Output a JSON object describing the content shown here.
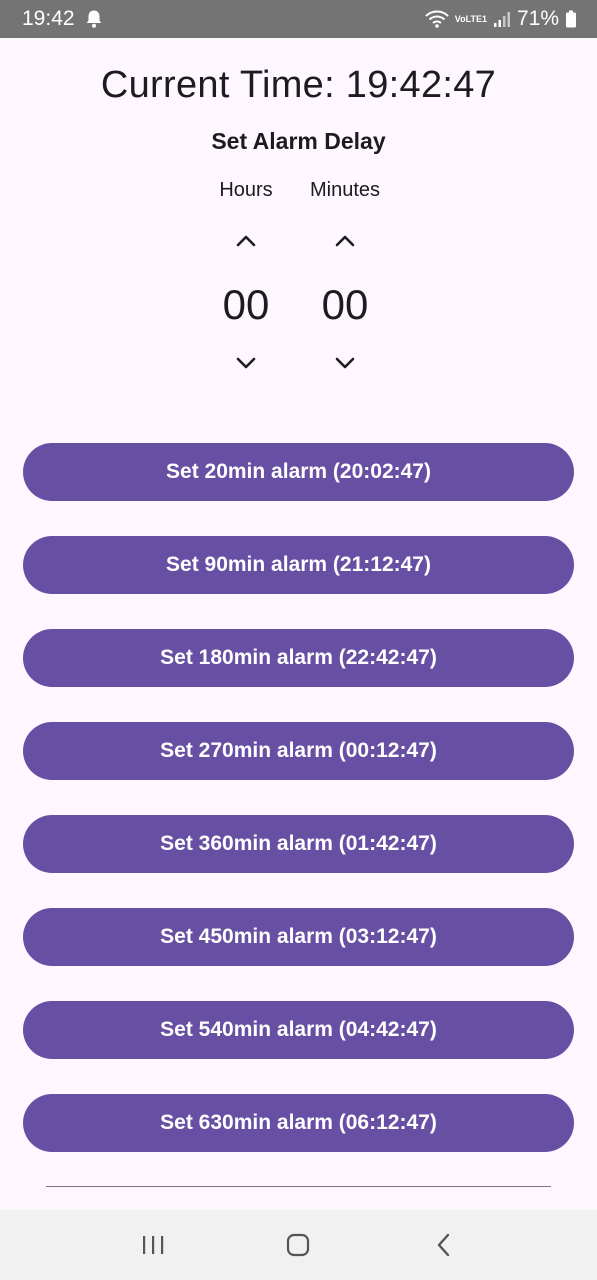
{
  "status_bar": {
    "time": "19:42",
    "battery": "71%",
    "network_label": "VoLTE1",
    "icons": [
      "bell-icon",
      "wifi-icon",
      "volte-icon",
      "signal-icon",
      "battery-icon"
    ]
  },
  "header": {
    "current_time": "Current Time: 19:42:47",
    "delay_title": "Set Alarm Delay"
  },
  "picker": {
    "hours_label": "Hours",
    "minutes_label": "Minutes",
    "hours_value": "00",
    "minutes_value": "00"
  },
  "alarms": [
    {
      "label": "Set 20min alarm (20:02:47)"
    },
    {
      "label": "Set 90min alarm (21:12:47)"
    },
    {
      "label": "Set 180min alarm (22:42:47)"
    },
    {
      "label": "Set 270min alarm (00:12:47)"
    },
    {
      "label": "Set 360min alarm (01:42:47)"
    },
    {
      "label": "Set 450min alarm (03:12:47)"
    },
    {
      "label": "Set 540min alarm (04:42:47)"
    },
    {
      "label": "Set 630min alarm (06:12:47)"
    }
  ],
  "colors": {
    "primary": "#6750a4",
    "background": "#fef7ff",
    "status_bar": "#747474",
    "nav_bar": "#f1f1f1"
  },
  "nav": {
    "icons": [
      "recent-apps-icon",
      "home-icon",
      "back-icon"
    ]
  }
}
